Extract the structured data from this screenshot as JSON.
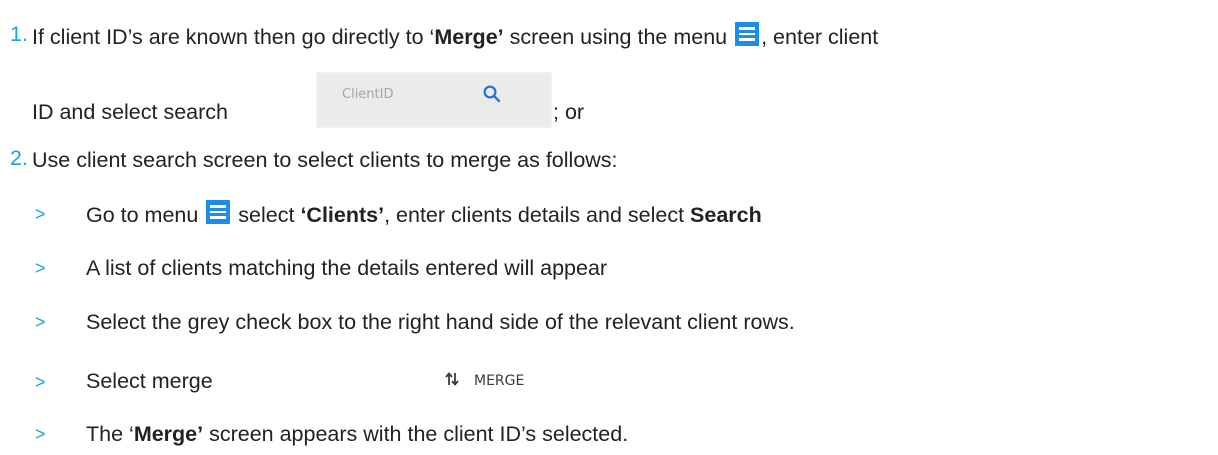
{
  "step1": {
    "number": "1.",
    "text_a": "If client ID’s are known then go directly to ‘",
    "text_bold": "Merge’",
    "text_b": " screen using the menu ",
    "text_c": ", enter client",
    "line2_a": "ID and select search",
    "line2_b": "; or"
  },
  "search": {
    "placeholder": "ClientID"
  },
  "step2": {
    "number": "2.",
    "text": "Use client search screen to select clients to merge as follows:",
    "bullets": [
      {
        "marker": ">",
        "text_a": "Go to menu ",
        "text_b": " select ",
        "bold_a": "‘Clients’",
        "text_c": ", enter clients details and select ",
        "bold_b": "Search"
      },
      {
        "marker": ">",
        "text": "A list of clients matching the details entered will appear"
      },
      {
        "marker": ">",
        "text": "Select the grey check box to the right hand side of the relevant client rows."
      },
      {
        "marker": ">",
        "text": "Select merge"
      },
      {
        "marker": ">",
        "text_a": "The ‘",
        "bold": "Merge’",
        "text_b": " screen appears with the client ID’s selected."
      }
    ]
  },
  "merge_button": {
    "label": "MERGE"
  },
  "icons": {
    "menu": "hamburger-menu-icon",
    "search": "search-icon",
    "merge": "merge-arrows-icon"
  },
  "colors": {
    "accent": "#1aa7d6",
    "menu_icon": "#1e8de8",
    "search_icon": "#2a6fdb",
    "text": "#222222"
  }
}
